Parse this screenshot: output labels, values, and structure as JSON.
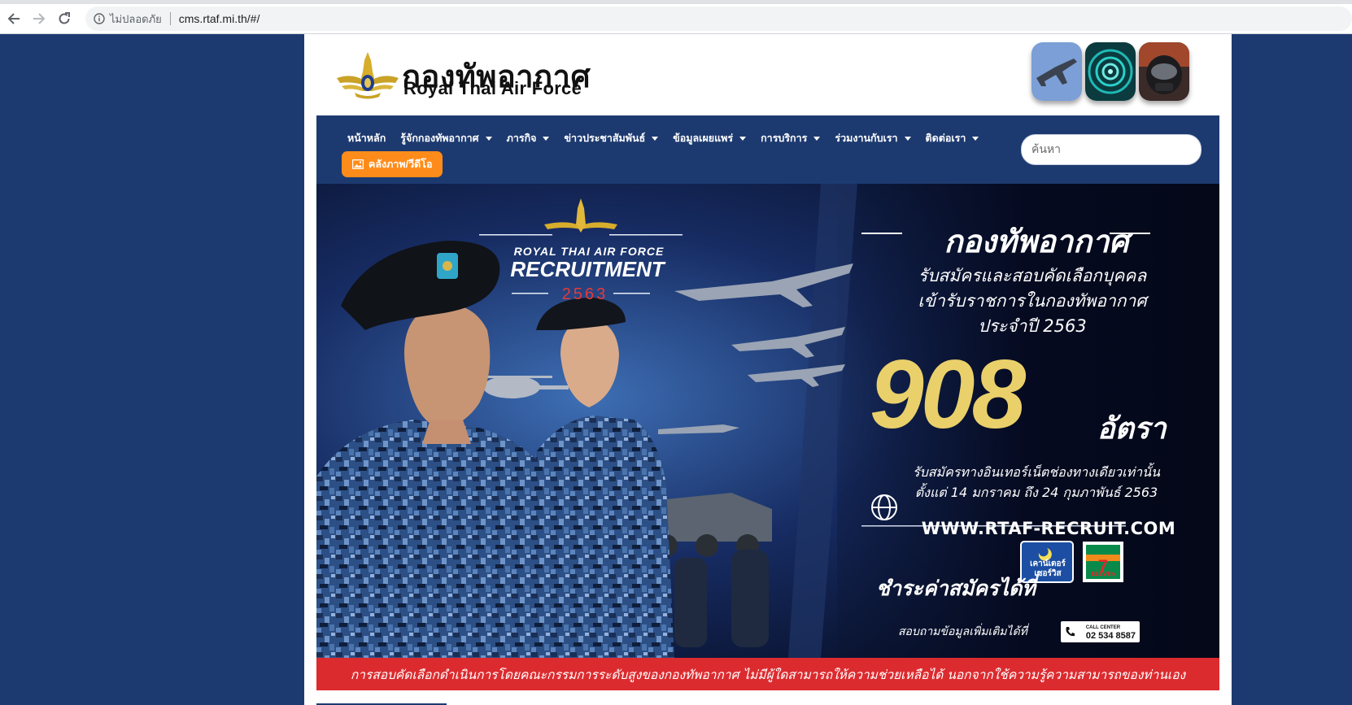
{
  "browser": {
    "insecure_label": "ไม่ปลอดภัย",
    "url": "cms.rtaf.mi.th/#/"
  },
  "header": {
    "logo_th": "กองทัพอากาศ",
    "logo_en": "Royal Thai Air Force"
  },
  "nav": {
    "items": [
      {
        "label": "หน้าหลัก",
        "dropdown": false
      },
      {
        "label": "รู้จักกองทัพอากาศ",
        "dropdown": true
      },
      {
        "label": "ภารกิจ",
        "dropdown": true
      },
      {
        "label": "ข่าวประชาสัมพันธ์",
        "dropdown": true
      },
      {
        "label": "ข้อมูลเผยแพร่",
        "dropdown": true
      },
      {
        "label": "การบริการ",
        "dropdown": true
      },
      {
        "label": "ร่วมงานกับเรา",
        "dropdown": true
      },
      {
        "label": "ติดต่อเรา",
        "dropdown": true
      }
    ],
    "gallery_label": "คลังภาพ/วีดีโอ",
    "search_placeholder": "ค้นหา"
  },
  "banner": {
    "brand_line": "ROYAL THAI AIR FORCE",
    "recruitment": "RECRUITMENT",
    "year": "2563",
    "title": "กองทัพอากาศ",
    "sub_lines": [
      "รับสมัครและสอบคัดเลือกบุคคล",
      "เข้ารับราชการในกองทัพอากาศ",
      "ประจำปี 2563"
    ],
    "count": "908",
    "count_unit": "อัตรา",
    "when_lines": [
      "รับสมัครทางอินเทอร์เน็ตช่องทางเดียวเท่านั้น",
      "ตั้งแต่ 14 มกราคม ถึง 24 กุมภาพันธ์ 2563"
    ],
    "website": "WWW.RTAF-RECRUIT.COM",
    "pay_text": "ชำระค่าสมัครได้ที่",
    "counter_service": "เคาน์เตอร์ เซอร์วิส",
    "seven_eleven": "ELEVEn",
    "ask_text": "สอบถามข้อมูลเพิ่มเติมได้ที่",
    "call_center": "CALL CENTER",
    "call_number": "02 534 8587",
    "colors": {
      "gold": "#ead06a",
      "red": "#e6393a"
    }
  },
  "notice": "การสอบคัดเลือกดำเนินการโดยคณะกรรมการระดับสูงของกองทัพอากาศ ไม่มีผู้ใดสามารถให้ความช่วยเหลือได้ นอกจากใช้ความรู้ความสามารถของท่านเอง"
}
